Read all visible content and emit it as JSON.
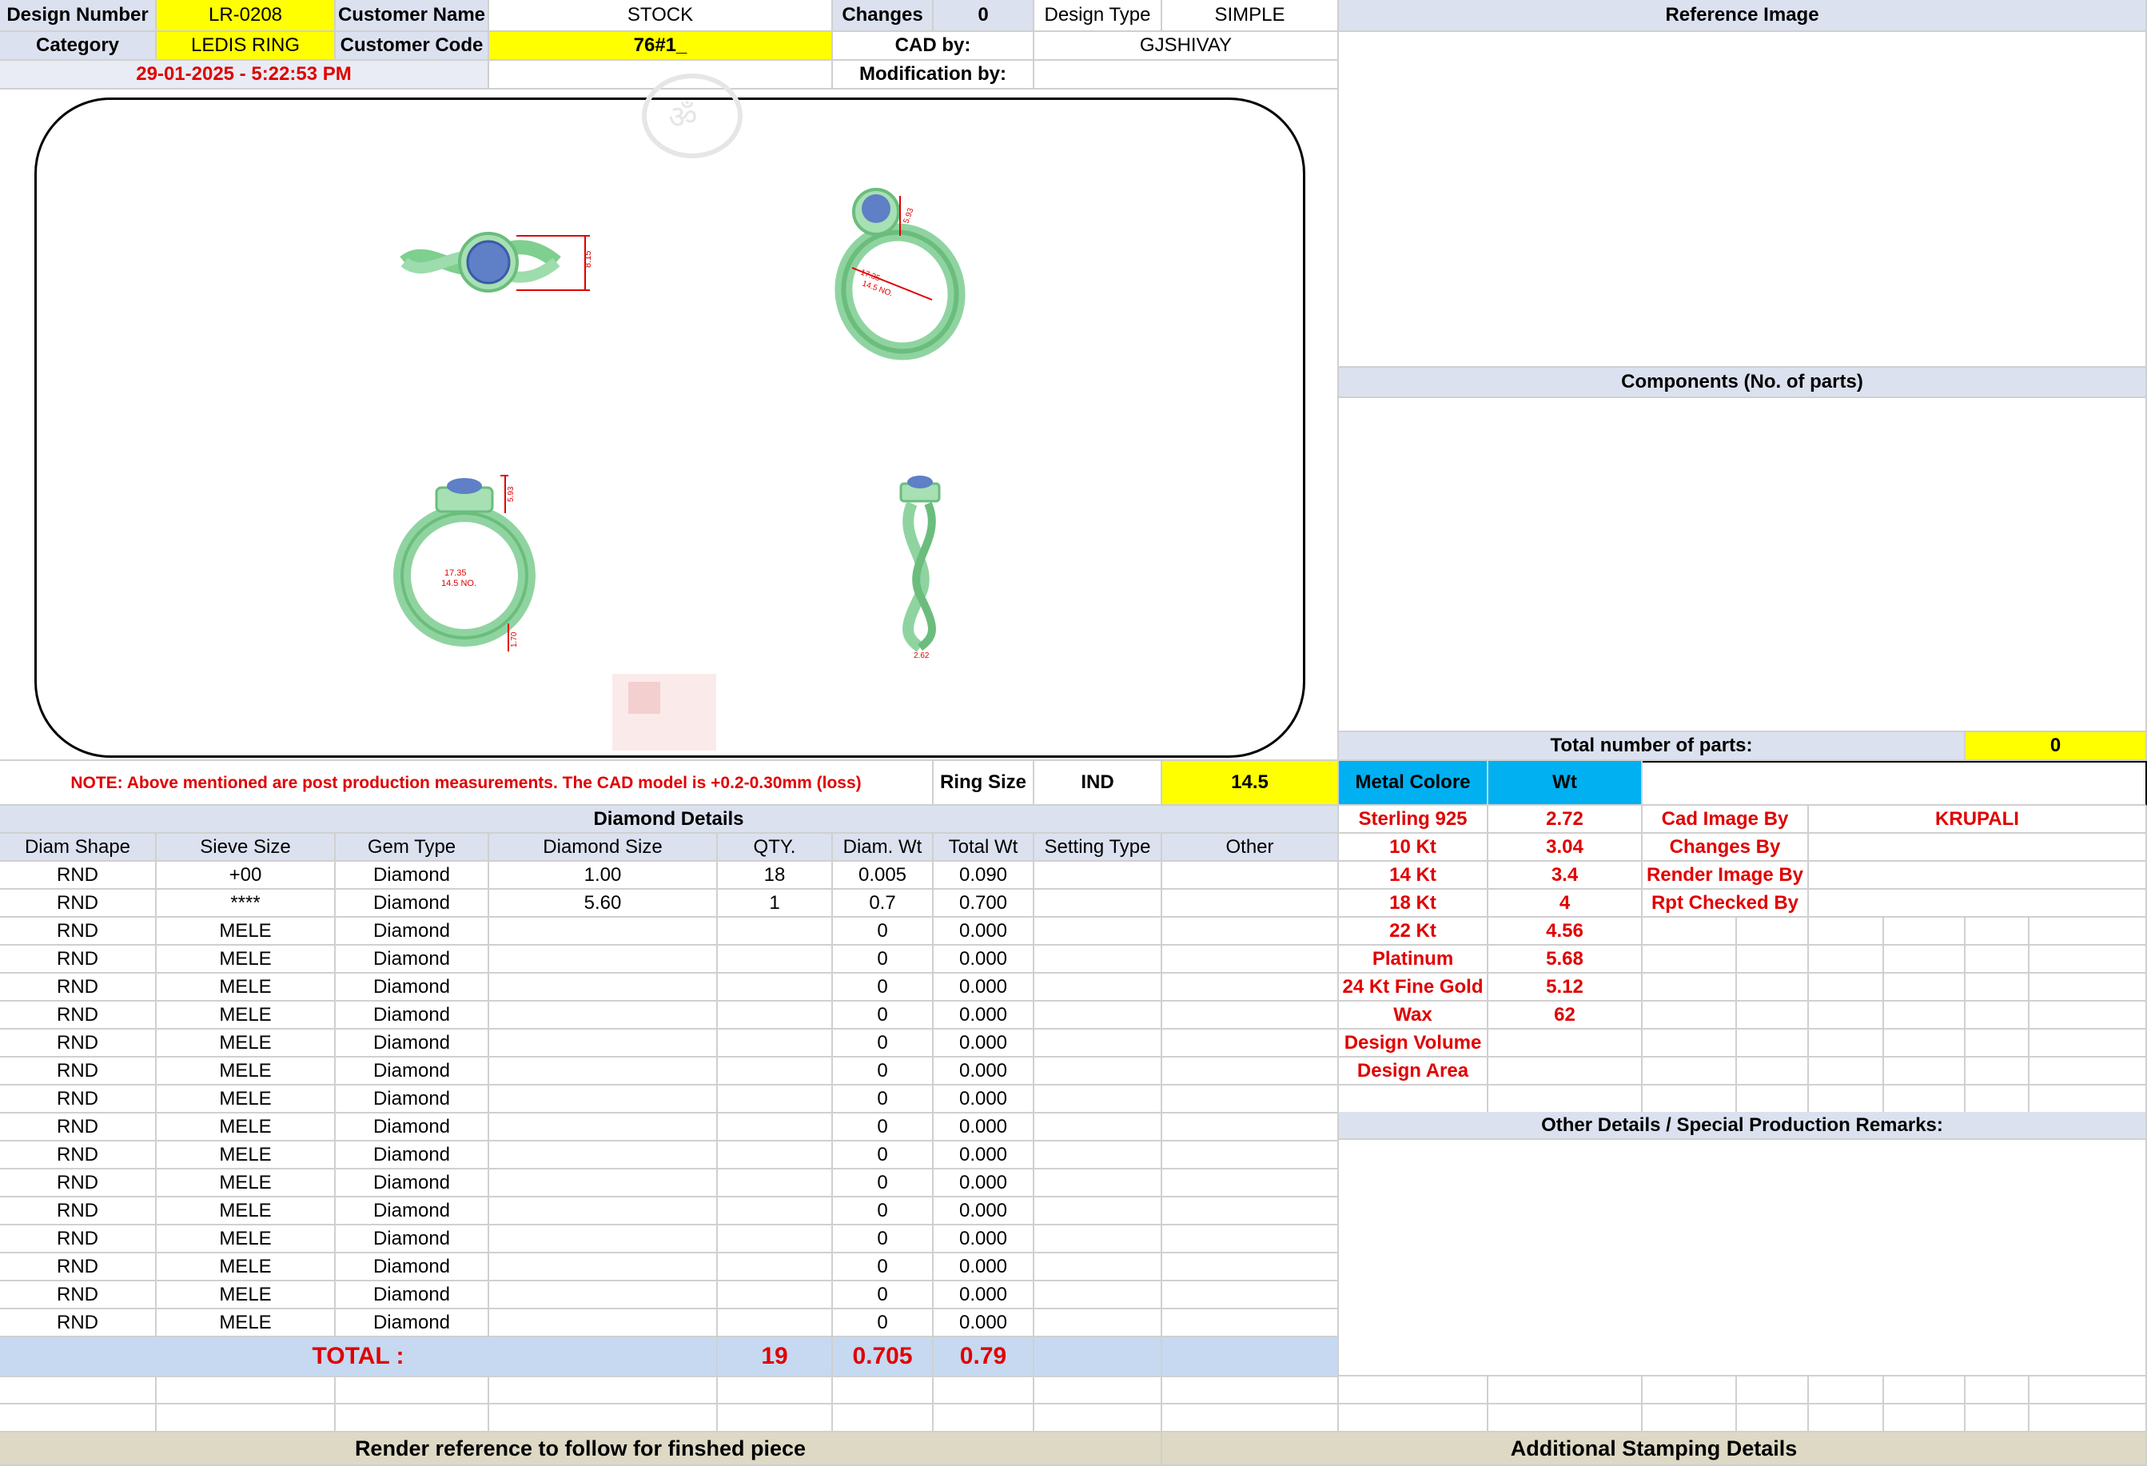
{
  "header": {
    "design_number_label": "Design Number",
    "design_number": "LR-0208",
    "customer_name_label": "Customer Name",
    "customer_name": "STOCK",
    "changes_label": "Changes",
    "changes": "0",
    "design_type_label": "Design Type",
    "design_type": "SIMPLE",
    "category_label": "Category",
    "category": "LEDIS RING",
    "customer_code_label": "Customer Code",
    "customer_code": "76#1_",
    "cad_by_label": "CAD by:",
    "cad_by": "GJSHIVAY",
    "timestamp": "29-01-2025 - 5:22:53 PM",
    "modification_by_label": "Modification by:",
    "modification_by": ""
  },
  "right_panel": {
    "reference_image_title": "Reference Image",
    "components_title": "Components (No. of parts)",
    "total_parts_label": "Total number of parts:",
    "total_parts": "0"
  },
  "ring_dims": {
    "top_height": "8.15",
    "head_height": "5.93",
    "inner_dia": "17.35",
    "size_no": "14.5 NO.",
    "shank_width": "1.70",
    "side_dim": "2.62"
  },
  "note": "NOTE: Above mentioned are post production measurements. The CAD model is +0.2-0.30mm (loss)",
  "ring_size": {
    "label": "Ring Size",
    "system": "IND",
    "value": "14.5"
  },
  "metal": {
    "colore_label": "Metal Colore",
    "wt_label": "Wt",
    "rows": [
      {
        "name": "Sterling 925",
        "wt": "2.72"
      },
      {
        "name": "10 Kt",
        "wt": "3.04"
      },
      {
        "name": "14 Kt",
        "wt": "3.4"
      },
      {
        "name": "18 Kt",
        "wt": "4"
      },
      {
        "name": "22 Kt",
        "wt": "4.56"
      },
      {
        "name": "Platinum",
        "wt": "5.68"
      },
      {
        "name": "24 Kt Fine Gold",
        "wt": "5.12"
      },
      {
        "name": "Wax",
        "wt": "62"
      },
      {
        "name": "Design Volume",
        "wt": ""
      },
      {
        "name": "Design Area",
        "wt": ""
      }
    ]
  },
  "credits": [
    {
      "label": "Cad Image By",
      "value": "KRUPALI"
    },
    {
      "label": "Changes By",
      "value": ""
    },
    {
      "label": "Render Image By",
      "value": ""
    },
    {
      "label": "Rpt Checked By",
      "value": ""
    }
  ],
  "other_details_title": "Other Details / Special Production Remarks:",
  "diamond": {
    "title": "Diamond Details",
    "headers": [
      "Diam Shape",
      "Sieve Size",
      "Gem Type",
      "Diamond Size",
      "QTY.",
      "Diam. Wt",
      "Total Wt",
      "Setting Type",
      "Other"
    ],
    "rows": [
      [
        "RND",
        "+00",
        "Diamond",
        "1.00",
        "18",
        "0.005",
        "0.090",
        "",
        ""
      ],
      [
        "RND",
        "****",
        "Diamond",
        "5.60",
        "1",
        "0.7",
        "0.700",
        "",
        ""
      ],
      [
        "RND",
        "MELE",
        "Diamond",
        "",
        "",
        "0",
        "0.000",
        "",
        ""
      ],
      [
        "RND",
        "MELE",
        "Diamond",
        "",
        "",
        "0",
        "0.000",
        "",
        ""
      ],
      [
        "RND",
        "MELE",
        "Diamond",
        "",
        "",
        "0",
        "0.000",
        "",
        ""
      ],
      [
        "RND",
        "MELE",
        "Diamond",
        "",
        "",
        "0",
        "0.000",
        "",
        ""
      ],
      [
        "RND",
        "MELE",
        "Diamond",
        "",
        "",
        "0",
        "0.000",
        "",
        ""
      ],
      [
        "RND",
        "MELE",
        "Diamond",
        "",
        "",
        "0",
        "0.000",
        "",
        ""
      ],
      [
        "RND",
        "MELE",
        "Diamond",
        "",
        "",
        "0",
        "0.000",
        "",
        ""
      ],
      [
        "RND",
        "MELE",
        "Diamond",
        "",
        "",
        "0",
        "0.000",
        "",
        ""
      ],
      [
        "RND",
        "MELE",
        "Diamond",
        "",
        "",
        "0",
        "0.000",
        "",
        ""
      ],
      [
        "RND",
        "MELE",
        "Diamond",
        "",
        "",
        "0",
        "0.000",
        "",
        ""
      ],
      [
        "RND",
        "MELE",
        "Diamond",
        "",
        "",
        "0",
        "0.000",
        "",
        ""
      ],
      [
        "RND",
        "MELE",
        "Diamond",
        "",
        "",
        "0",
        "0.000",
        "",
        ""
      ],
      [
        "RND",
        "MELE",
        "Diamond",
        "",
        "",
        "0",
        "0.000",
        "",
        ""
      ],
      [
        "RND",
        "MELE",
        "Diamond",
        "",
        "",
        "0",
        "0.000",
        "",
        ""
      ],
      [
        "RND",
        "MELE",
        "Diamond",
        "",
        "",
        "0",
        "0.000",
        "",
        ""
      ]
    ],
    "total_label": "TOTAL :",
    "total_qty": "19",
    "total_diam_wt": "0.705",
    "total_wt": "0.79"
  },
  "footer": {
    "render_reference": "Render reference to follow for finshed piece",
    "stamping": "Additional Stamping Details"
  },
  "colors": {
    "yellow": "#ffff00",
    "header_gray": "#dbe1ee",
    "total_blue": "#c6d9f1",
    "metal_blue": "#00b0f0",
    "ring_green": "#8fd4a0",
    "gem_blue": "#5f7fc6",
    "dim_red": "#e00000"
  }
}
